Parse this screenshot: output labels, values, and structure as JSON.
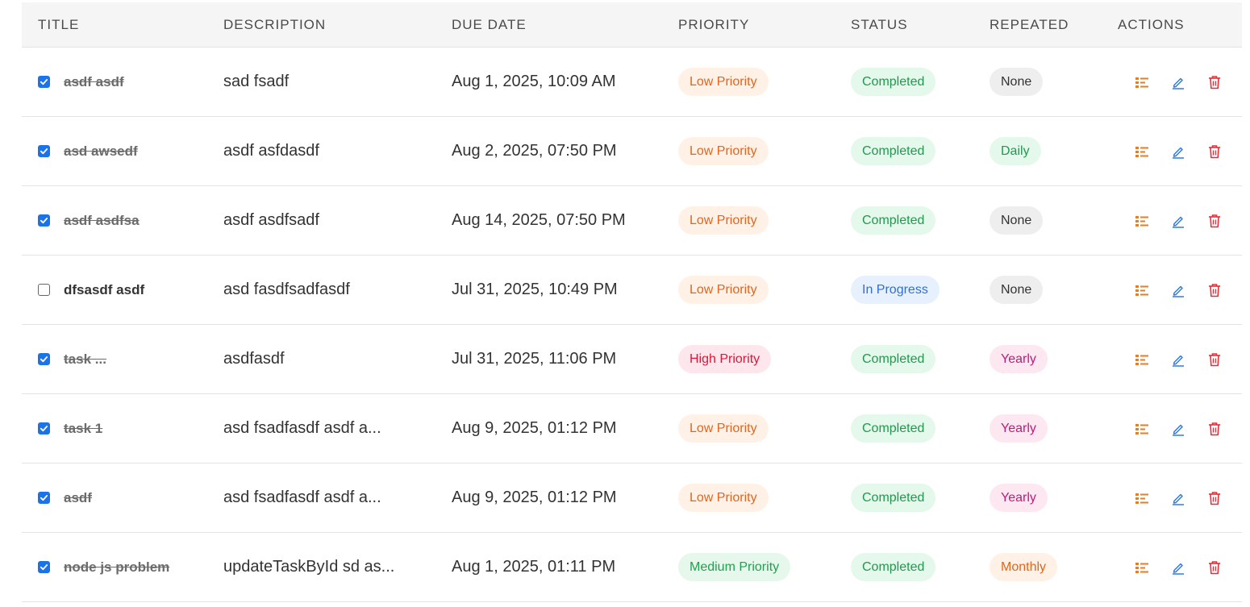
{
  "table": {
    "headers": {
      "title": "TITLE",
      "description": "DESCRIPTION",
      "due_date": "DUE DATE",
      "priority": "PRIORITY",
      "status": "STATUS",
      "repeated": "REPEATED",
      "actions": "ACTIONS"
    },
    "rows": [
      {
        "checked": true,
        "title": "asdf asdf",
        "description": "sad fsadf",
        "due": "Aug 1, 2025, 10:09 AM",
        "priority": "Low Priority",
        "priority_level": "low",
        "status": "Completed",
        "status_kind": "completed",
        "repeated": "None",
        "repeated_kind": "none"
      },
      {
        "checked": true,
        "title": "asd awsedf",
        "description": "asdf asfdasdf",
        "due": "Aug 2, 2025, 07:50 PM",
        "priority": "Low Priority",
        "priority_level": "low",
        "status": "Completed",
        "status_kind": "completed",
        "repeated": "Daily",
        "repeated_kind": "daily"
      },
      {
        "checked": true,
        "title": "asdf asdfsa",
        "description": "asdf asdfsadf",
        "due": "Aug 14, 2025, 07:50 PM",
        "priority": "Low Priority",
        "priority_level": "low",
        "status": "Completed",
        "status_kind": "completed",
        "repeated": "None",
        "repeated_kind": "none"
      },
      {
        "checked": false,
        "title": "dfsasdf asdf",
        "description": "asd fasdfsadfasdf",
        "due": "Jul 31, 2025, 10:49 PM",
        "priority": "Low Priority",
        "priority_level": "low",
        "status": "In Progress",
        "status_kind": "progress",
        "repeated": "None",
        "repeated_kind": "none"
      },
      {
        "checked": true,
        "title": "task ...",
        "description": "asdfasdf",
        "due": "Jul 31, 2025, 11:06 PM",
        "priority": "High Priority",
        "priority_level": "high",
        "status": "Completed",
        "status_kind": "completed",
        "repeated": "Yearly",
        "repeated_kind": "yearly"
      },
      {
        "checked": true,
        "title": "task 1",
        "description": "asd fsadfasdf asdf a...",
        "due": "Aug 9, 2025, 01:12 PM",
        "priority": "Low Priority",
        "priority_level": "low",
        "status": "Completed",
        "status_kind": "completed",
        "repeated": "Yearly",
        "repeated_kind": "yearly"
      },
      {
        "checked": true,
        "title": "asdf",
        "description": "asd fsadfasdf asdf a...",
        "due": "Aug 9, 2025, 01:12 PM",
        "priority": "Low Priority",
        "priority_level": "low",
        "status": "Completed",
        "status_kind": "completed",
        "repeated": "Yearly",
        "repeated_kind": "yearly"
      },
      {
        "checked": true,
        "title": "node js problem",
        "description": "updateTaskById sd as...",
        "due": "Aug 1, 2025, 01:11 PM",
        "priority": "Medium Priority",
        "priority_level": "medium",
        "status": "Completed",
        "status_kind": "completed",
        "repeated": "Monthly",
        "repeated_kind": "monthly"
      }
    ],
    "action_icons": [
      "details-list-icon",
      "edit-pencil-icon",
      "delete-trash-icon"
    ]
  },
  "colors": {
    "checkbox_checked": "#1a73e8",
    "details_icon": "#e67e22",
    "edit_icon": "#2f7be0",
    "delete_icon": "#e0303a"
  }
}
